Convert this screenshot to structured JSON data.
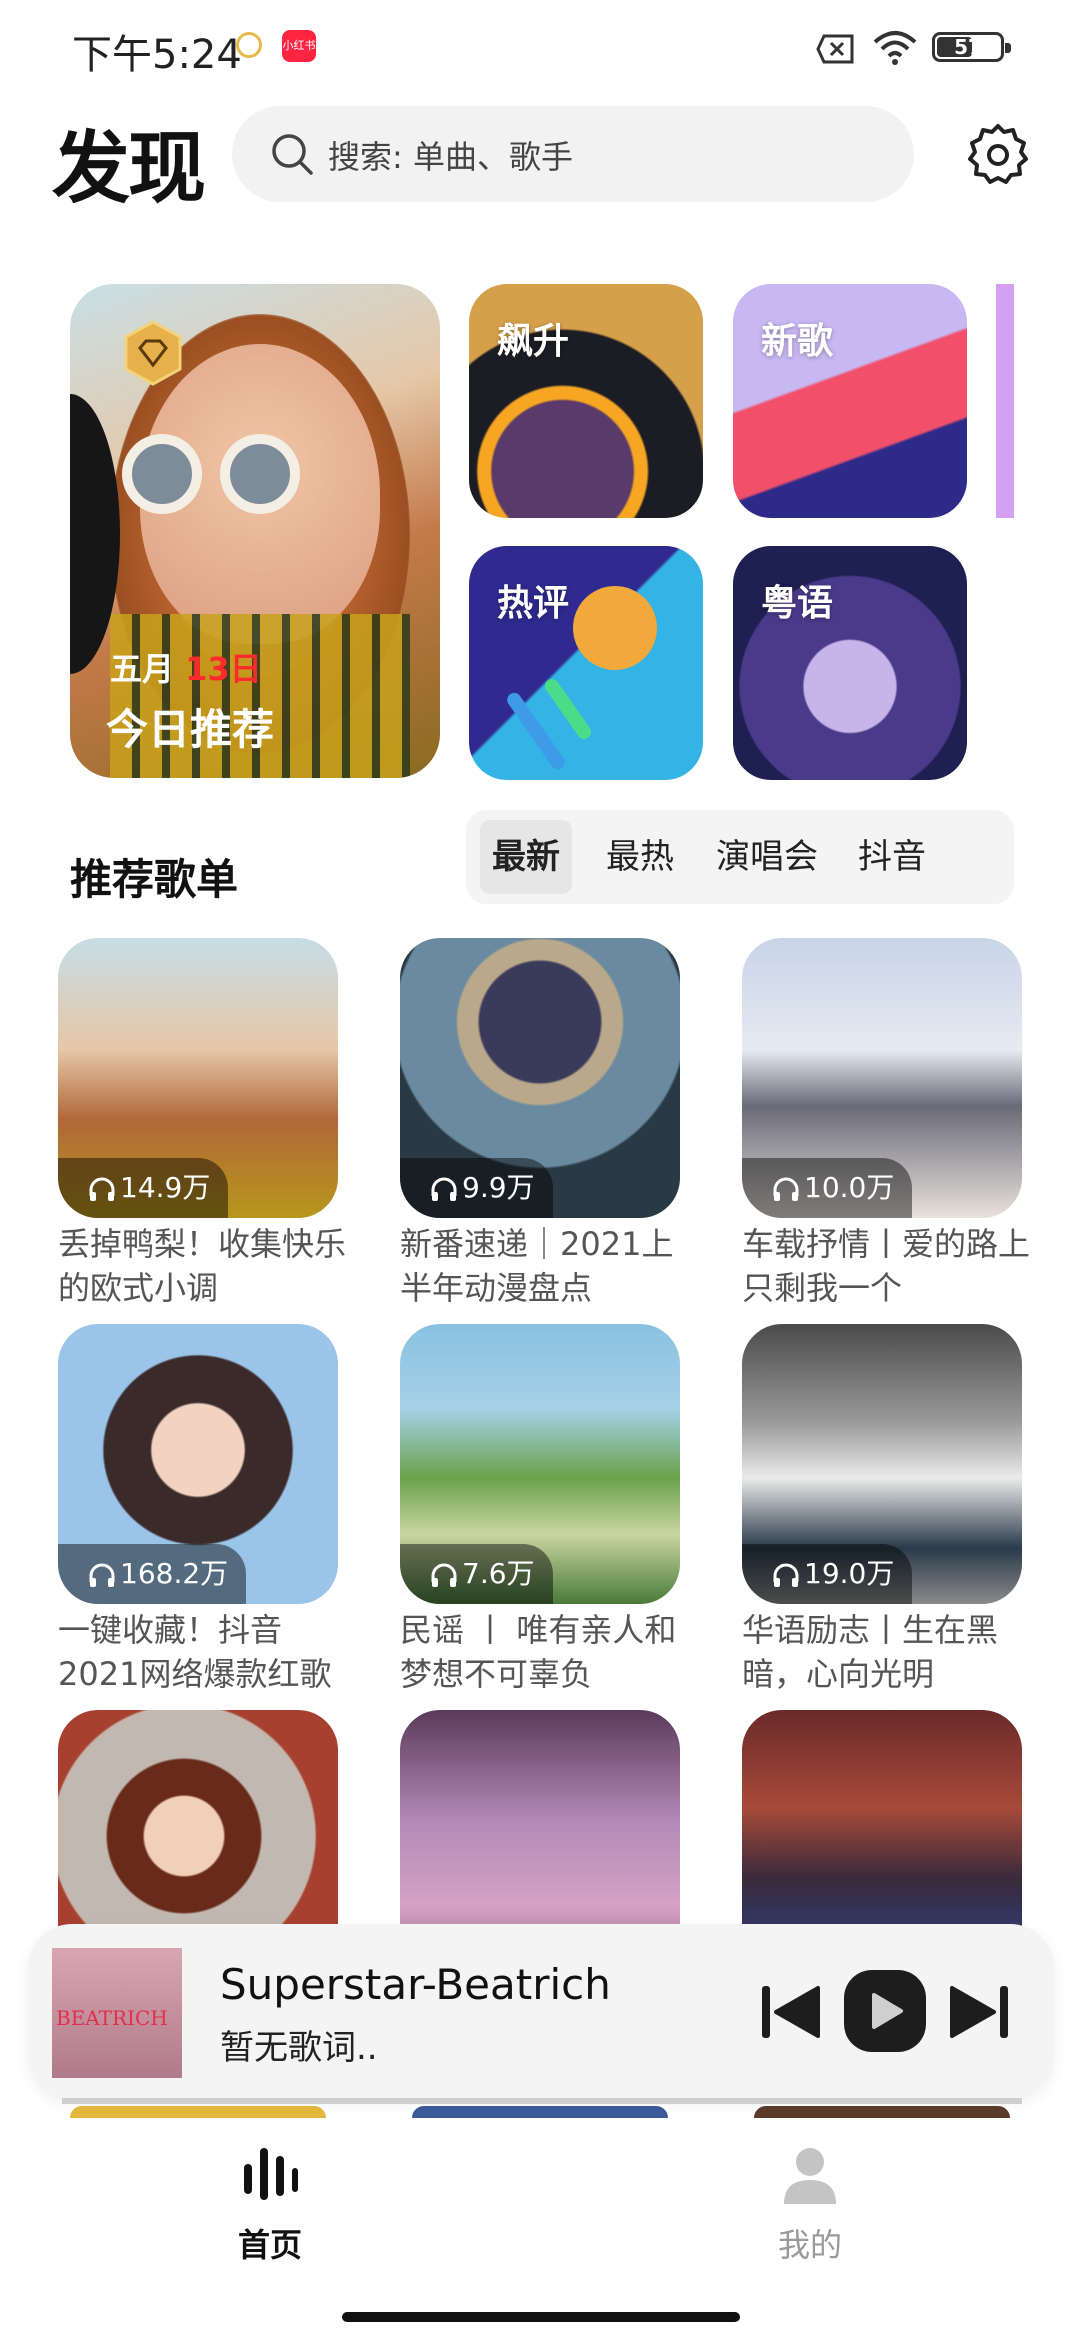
{
  "status": {
    "time": "下午5:24",
    "battery": "57",
    "app_badge": "小红书",
    "battery_fraction": 0.57
  },
  "header": {
    "title": "发现",
    "search_placeholder": "搜索: 单曲、歌手"
  },
  "banners": {
    "hero": {
      "month": "五月",
      "day": "13日",
      "label": "今日推荐"
    },
    "tiles": [
      "飙升",
      "新歌",
      "热评",
      "粤语"
    ]
  },
  "section": {
    "title": "推荐歌单",
    "tabs": [
      "最新",
      "最热",
      "演唱会",
      "抖音"
    ],
    "active_tab": "最新"
  },
  "playlists": [
    {
      "plays": "14.9万",
      "name": "丢掉鸭梨！收集快乐的欧式小调"
    },
    {
      "plays": "9.9万",
      "name": "新番速递｜2021上半年动漫盘点"
    },
    {
      "plays": "10.0万",
      "name": "车载抒情丨爱的路上只剩我一个"
    },
    {
      "plays": "168.2万",
      "name": "一键收藏！抖音2021网络爆款红歌"
    },
    {
      "plays": "7.6万",
      "name": "民谣 丨 唯有亲人和梦想不可辜负"
    },
    {
      "plays": "19.0万",
      "name": "华语励志丨生在黑暗，心向光明"
    },
    {
      "plays": "",
      "name": ""
    },
    {
      "plays": "",
      "name": ""
    },
    {
      "plays": "",
      "name": ""
    }
  ],
  "player": {
    "song": "Superstar-Beatrich",
    "lyric": "暂无歌词..",
    "cover_text": "BEATRICH"
  },
  "nav": {
    "home": "首页",
    "mine": "我的"
  },
  "colors": {
    "accent_red": "#ff2a2a",
    "dark": "#1d1d1d",
    "inactive": "#9a9a9a"
  }
}
